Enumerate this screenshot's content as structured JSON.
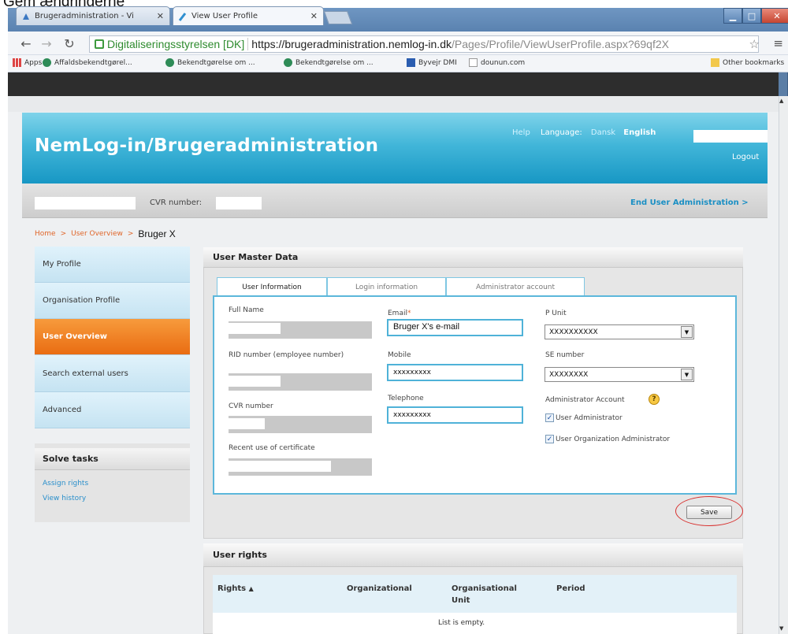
{
  "caption": "Gem ændringerne",
  "browser": {
    "tabs": [
      {
        "label": "Brugeradministration - Vi"
      },
      {
        "label": "View User Profile"
      }
    ],
    "site_identity": "Digitaliseringsstyrelsen [DK]",
    "url_host": "https://brugeradministration.nemlog-in.dk",
    "url_path": "/Pages/Profile/ViewUserProfile.aspx?69qf2X",
    "bookmarks": [
      {
        "label": "Apps"
      },
      {
        "label": "Affaldsbekendtgørel..."
      },
      {
        "label": "Bekendtgørelse om ..."
      },
      {
        "label": "Bekendtgørelse om ..."
      },
      {
        "label": "Byvejr DMI"
      },
      {
        "label": "dounun.com"
      }
    ],
    "other_bookmarks": "Other bookmarks"
  },
  "header": {
    "title": "NemLog-in/Brugeradministration",
    "help": "Help",
    "language_label": "Language:",
    "dansk": "Dansk",
    "english": "English",
    "logout": "Logout"
  },
  "cvr_bar": {
    "cvr_label": "CVR number:",
    "end_user_link": "End User Administration >"
  },
  "breadcrumb": {
    "home": "Home",
    "user_overview": "User Overview",
    "current": "Bruger X"
  },
  "left_nav": {
    "items": [
      {
        "label": "My Profile"
      },
      {
        "label": "Organisation Profile"
      },
      {
        "label": "User Overview"
      },
      {
        "label": "Search external users"
      },
      {
        "label": "Advanced"
      }
    ],
    "tasks_title": "Solve tasks",
    "tasks": [
      {
        "label": "Assign rights"
      },
      {
        "label": "View history"
      }
    ]
  },
  "master": {
    "title": "User Master Data",
    "tabs": [
      {
        "label": "User Information"
      },
      {
        "label": "Login information"
      },
      {
        "label": "Administrator account"
      }
    ],
    "full_name_label": "Full Name",
    "rid_label": "RID number (employee number)",
    "cvr_label": "CVR number",
    "recent_cert_label": "Recent use of certificate",
    "email_label": "Email",
    "email_value": "Bruger X's e-mail",
    "mobile_label": "Mobile",
    "mobile_value": "xxxxxxxxx",
    "telephone_label": "Telephone",
    "telephone_value": "xxxxxxxxx",
    "p_unit_label": "P Unit",
    "p_unit_value": "XXXXXXXXXX",
    "se_label": "SE number",
    "se_value": "XXXXXXXX",
    "admin_account_label": "Administrator Account",
    "user_admin_label": "User Administrator",
    "user_admin_checked": true,
    "org_admin_label": "User Organization Administrator",
    "org_admin_checked": true,
    "save": "Save"
  },
  "rights": {
    "title": "User rights",
    "col_rights": "Rights",
    "col_organizational": "Organizational",
    "col_unit_line1": "Organisational",
    "col_unit_line2": "Unit",
    "col_period": "Period",
    "empty": "List is empty."
  },
  "colors": {
    "banner": "#1797c4",
    "active_nav": "#e96c12",
    "link": "#2a8fcb",
    "annotation": "#d8302e"
  }
}
